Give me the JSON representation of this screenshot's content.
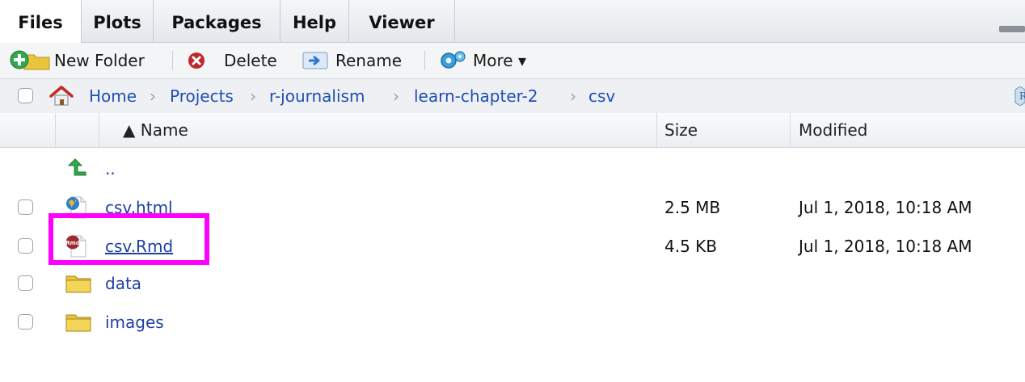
{
  "tabs": [
    {
      "label": "Files"
    },
    {
      "label": "Plots"
    },
    {
      "label": "Packages"
    },
    {
      "label": "Help"
    },
    {
      "label": "Viewer"
    }
  ],
  "toolbar": {
    "new_folder": "New Folder",
    "delete": "Delete",
    "rename": "Rename",
    "more": "More ▾"
  },
  "breadcrumb": {
    "items": [
      "Home",
      "Projects",
      "r-journalism",
      "learn-chapter-2",
      "csv"
    ],
    "separator": "›"
  },
  "columns": {
    "name": "▲ Name",
    "size": "Size",
    "modified": "Modified"
  },
  "files": {
    "parent": "..",
    "rows": [
      {
        "name": "csv.html",
        "icon": "html-file-icon",
        "size": "2.5 MB",
        "modified": "Jul 1, 2018, 10:18 AM"
      },
      {
        "name": "csv.Rmd",
        "icon": "rmd-file-icon",
        "size": "4.5 KB",
        "modified": "Jul 1, 2018, 10:18 AM"
      },
      {
        "name": "data",
        "icon": "folder-icon",
        "size": "",
        "modified": ""
      },
      {
        "name": "images",
        "icon": "folder-icon",
        "size": "",
        "modified": ""
      }
    ]
  },
  "colors": {
    "link": "#1f3fa4",
    "highlight": "#ff00ff",
    "folder": "#e8c53a",
    "up_arrow": "#2fa84f"
  }
}
